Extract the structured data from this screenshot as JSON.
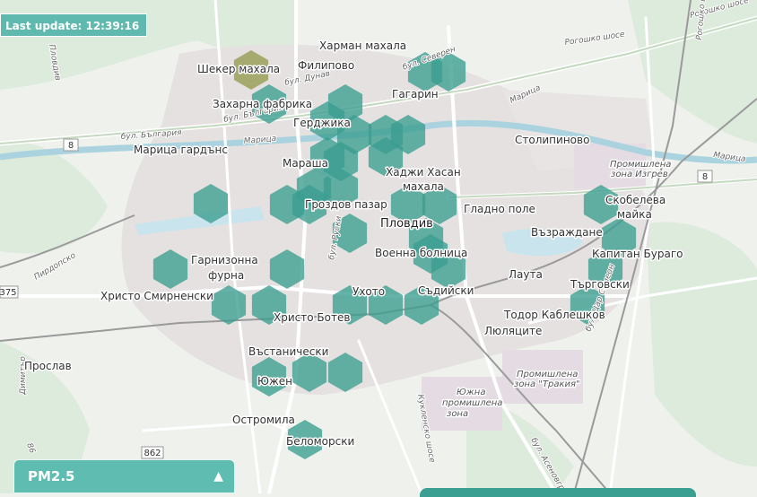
{
  "status": {
    "last_update": "Last update: 12:39:16"
  },
  "panel": {
    "pollutant": "PM2.5",
    "toggle_icon": "chevron-up-icon"
  },
  "colors": {
    "accent": "#60b9ae",
    "hex_fill": "#3a9e90",
    "hex_highlight": "#9aa05a"
  },
  "map": {
    "districts": {
      "harman_mahala": "Харман махала",
      "sheker_mahala": "Шекер махала",
      "filipovo": "Филипово",
      "gagarin": "Гагарин",
      "zaharna_fabrika": "Захарна фабрика",
      "gerdzhika": "Герджика",
      "stolipinovo": "Столипиново",
      "maritsa_gardens": "Марица гардънс",
      "marasha": "Мараша",
      "hadzhi_hasan": "Хаджи Хасан",
      "hadzhi_hasan_mahala": "махала",
      "skobeleva": "Скобелева",
      "maika": "майка",
      "grozdov_pazar": "Гроздов пазар",
      "plovdiv": "Пловдив",
      "gladno_pole": "Гладно поле",
      "vazrazhdane": "Възраждане",
      "kapitan_burago": "Капитан Бураго",
      "garnizonna": "Гарнизонна",
      "furna": "фурна",
      "voenna_bolnitsa": "Военна болница",
      "lauta": "Лаута",
      "hristo_smirnenski": "Христо Смирненски",
      "uhoto": "Ухото",
      "sadiyski": "Съдийски",
      "targovski": "Търговски",
      "hristo_botev": "Христо Ботев",
      "todor_kableshkov": "Тодор Каблешков",
      "lyulyatsite": "Люляците",
      "vastanicheski": "Въстанически",
      "proslav": "Прослав",
      "yuzhen": "Южен",
      "ostromila": "Остромила",
      "belomorski": "Беломорски"
    },
    "zones": {
      "izgrev_1": "Промишлена",
      "izgrev_2": "зона Изгрев",
      "trakia_1": "Промишлена",
      "trakia_2": "зона \"Тракия\"",
      "south_1": "Южна",
      "south_2": "промишлена",
      "south_3": "зона"
    },
    "roads": {
      "sever": "бул. Северен",
      "dunav": "бул. Дунав",
      "bulgaria_1": "бул. България",
      "bulgaria_2": "бул. България",
      "maritsa_1": "Марица",
      "maritsa_2": "Марица",
      "maritsa_3": "Марица",
      "rogosh_1": "Рогошко шосе",
      "rogosh_2": "Рогошко шосе",
      "rogosh_3": "Рогошко шосе",
      "asenovgrad": "бул. Асеновградско",
      "kukleno": "Кукленско шосе",
      "tsar_simeon": "бул. Цар Симеон",
      "ruski": "бул. Руски",
      "pirdop": "Пирдопско",
      "plovdiv_road": "Пловдив",
      "dimitar": "Димитър",
      "r375": "375",
      "r8a": "8",
      "r8b": "8",
      "r862": "862",
      "r86": "86"
    }
  }
}
